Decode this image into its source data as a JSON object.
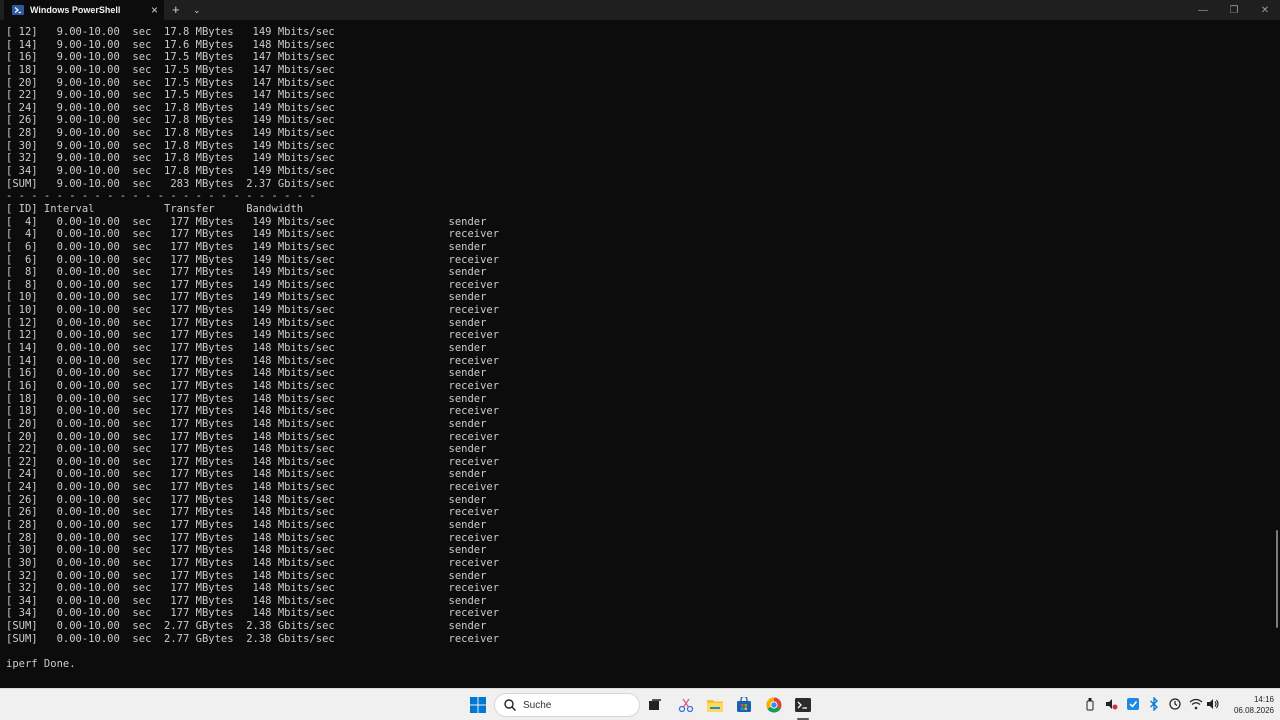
{
  "window": {
    "tab_title": "Windows PowerShell",
    "tab_close_glyph": "×",
    "new_tab_glyph": "+",
    "dropdown_glyph": "⌄",
    "controls": {
      "minimize": "—",
      "maximize": "❐",
      "close": "✕"
    }
  },
  "terminal": {
    "lines": [
      "[ 12]   9.00-10.00  sec  17.8 MBytes   149 Mbits/sec",
      "[ 14]   9.00-10.00  sec  17.6 MBytes   148 Mbits/sec",
      "[ 16]   9.00-10.00  sec  17.5 MBytes   147 Mbits/sec",
      "[ 18]   9.00-10.00  sec  17.5 MBytes   147 Mbits/sec",
      "[ 20]   9.00-10.00  sec  17.5 MBytes   147 Mbits/sec",
      "[ 22]   9.00-10.00  sec  17.5 MBytes   147 Mbits/sec",
      "[ 24]   9.00-10.00  sec  17.8 MBytes   149 Mbits/sec",
      "[ 26]   9.00-10.00  sec  17.8 MBytes   149 Mbits/sec",
      "[ 28]   9.00-10.00  sec  17.8 MBytes   149 Mbits/sec",
      "[ 30]   9.00-10.00  sec  17.8 MBytes   149 Mbits/sec",
      "[ 32]   9.00-10.00  sec  17.8 MBytes   149 Mbits/sec",
      "[ 34]   9.00-10.00  sec  17.8 MBytes   149 Mbits/sec",
      "[SUM]   9.00-10.00  sec   283 MBytes  2.37 Gbits/sec",
      "- - - - - - - - - - - - - - - - - - - - - - - - -",
      "[ ID] Interval           Transfer     Bandwidth",
      "[  4]   0.00-10.00  sec   177 MBytes   149 Mbits/sec                  sender",
      "[  4]   0.00-10.00  sec   177 MBytes   149 Mbits/sec                  receiver",
      "[  6]   0.00-10.00  sec   177 MBytes   149 Mbits/sec                  sender",
      "[  6]   0.00-10.00  sec   177 MBytes   149 Mbits/sec                  receiver",
      "[  8]   0.00-10.00  sec   177 MBytes   149 Mbits/sec                  sender",
      "[  8]   0.00-10.00  sec   177 MBytes   149 Mbits/sec                  receiver",
      "[ 10]   0.00-10.00  sec   177 MBytes   149 Mbits/sec                  sender",
      "[ 10]   0.00-10.00  sec   177 MBytes   149 Mbits/sec                  receiver",
      "[ 12]   0.00-10.00  sec   177 MBytes   149 Mbits/sec                  sender",
      "[ 12]   0.00-10.00  sec   177 MBytes   149 Mbits/sec                  receiver",
      "[ 14]   0.00-10.00  sec   177 MBytes   148 Mbits/sec                  sender",
      "[ 14]   0.00-10.00  sec   177 MBytes   148 Mbits/sec                  receiver",
      "[ 16]   0.00-10.00  sec   177 MBytes   148 Mbits/sec                  sender",
      "[ 16]   0.00-10.00  sec   177 MBytes   148 Mbits/sec                  receiver",
      "[ 18]   0.00-10.00  sec   177 MBytes   148 Mbits/sec                  sender",
      "[ 18]   0.00-10.00  sec   177 MBytes   148 Mbits/sec                  receiver",
      "[ 20]   0.00-10.00  sec   177 MBytes   148 Mbits/sec                  sender",
      "[ 20]   0.00-10.00  sec   177 MBytes   148 Mbits/sec                  receiver",
      "[ 22]   0.00-10.00  sec   177 MBytes   148 Mbits/sec                  sender",
      "[ 22]   0.00-10.00  sec   177 MBytes   148 Mbits/sec                  receiver",
      "[ 24]   0.00-10.00  sec   177 MBytes   148 Mbits/sec                  sender",
      "[ 24]   0.00-10.00  sec   177 MBytes   148 Mbits/sec                  receiver",
      "[ 26]   0.00-10.00  sec   177 MBytes   148 Mbits/sec                  sender",
      "[ 26]   0.00-10.00  sec   177 MBytes   148 Mbits/sec                  receiver",
      "[ 28]   0.00-10.00  sec   177 MBytes   148 Mbits/sec                  sender",
      "[ 28]   0.00-10.00  sec   177 MBytes   148 Mbits/sec                  receiver",
      "[ 30]   0.00-10.00  sec   177 MBytes   148 Mbits/sec                  sender",
      "[ 30]   0.00-10.00  sec   177 MBytes   148 Mbits/sec                  receiver",
      "[ 32]   0.00-10.00  sec   177 MBytes   148 Mbits/sec                  sender",
      "[ 32]   0.00-10.00  sec   177 MBytes   148 Mbits/sec                  receiver",
      "[ 34]   0.00-10.00  sec   177 MBytes   148 Mbits/sec                  sender",
      "[ 34]   0.00-10.00  sec   177 MBytes   148 Mbits/sec                  receiver",
      "[SUM]   0.00-10.00  sec  2.77 GBytes  2.38 Gbits/sec                  sender",
      "[SUM]   0.00-10.00  sec  2.77 GBytes  2.38 Gbits/sec                  receiver",
      "",
      "iperf Done."
    ],
    "text_color": "#cccccc",
    "background_color": "#0c0c0c"
  },
  "taskbar": {
    "search_label": "Suche",
    "pinned_icons": [
      "windows-start-icon",
      "task-view-icon",
      "snipping-tool-icon",
      "file-explorer-icon",
      "microsoft-store-icon",
      "chrome-icon",
      "terminal-icon"
    ],
    "clock_time": "14:16",
    "clock_date": "06.08.2026",
    "accent_color": "#0078d4"
  }
}
